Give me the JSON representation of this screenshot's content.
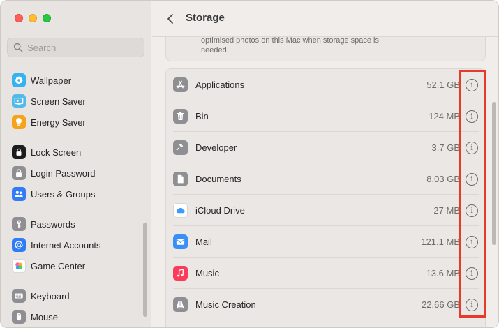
{
  "window": {
    "title": "Storage"
  },
  "search": {
    "placeholder": "Search"
  },
  "sidebar": {
    "items": [
      {
        "label": "Wallpaper",
        "icon": "wallpaper-icon",
        "color": "#35b2f0"
      },
      {
        "label": "Screen Saver",
        "icon": "screen-saver-icon",
        "color": "#53b9e8"
      },
      {
        "label": "Energy Saver",
        "icon": "energy-saver-icon",
        "color": "#f7a21b"
      },
      {
        "label": "Lock Screen",
        "icon": "lock-screen-icon",
        "color": "#1c1c1e"
      },
      {
        "label": "Login Password",
        "icon": "lock-icon",
        "color": "#8e8e93"
      },
      {
        "label": "Users & Groups",
        "icon": "users-icon",
        "color": "#2f7cf6"
      },
      {
        "label": "Passwords",
        "icon": "key-icon",
        "color": "#8e8e93"
      },
      {
        "label": "Internet Accounts",
        "icon": "at-icon",
        "color": "#2f7cf6"
      },
      {
        "label": "Game Center",
        "icon": "game-center-icon",
        "color": "#ffffff"
      },
      {
        "label": "Keyboard",
        "icon": "keyboard-icon",
        "color": "#8e8e93"
      },
      {
        "label": "Mouse",
        "icon": "mouse-icon",
        "color": "#8e8e93"
      }
    ]
  },
  "prev_card": {
    "text": "optimised photos on this Mac when storage space is needed."
  },
  "storage": {
    "rows": [
      {
        "name": "Applications",
        "size": "52.1 GB",
        "icon": "applications-icon",
        "color": "#8e8e93"
      },
      {
        "name": "Bin",
        "size": "124 MB",
        "icon": "bin-icon",
        "color": "#8e8e93"
      },
      {
        "name": "Developer",
        "size": "3.7 GB",
        "icon": "hammer-icon",
        "color": "#8e8e93"
      },
      {
        "name": "Documents",
        "size": "8.03 GB",
        "icon": "document-icon",
        "color": "#8e8e93"
      },
      {
        "name": "iCloud Drive",
        "size": "27 MB",
        "icon": "icloud-icon",
        "color": "#ffffff"
      },
      {
        "name": "Mail",
        "size": "121.1 MB",
        "icon": "mail-icon",
        "color": "#3a8ff7"
      },
      {
        "name": "Music",
        "size": "13.6 MB",
        "icon": "music-icon",
        "color": "#fa3c5a"
      },
      {
        "name": "Music Creation",
        "size": "22.66 GB",
        "icon": "music-creation-icon",
        "color": "#8e8e93"
      }
    ],
    "info_glyph": "i"
  },
  "highlight_color": "#e8392b"
}
